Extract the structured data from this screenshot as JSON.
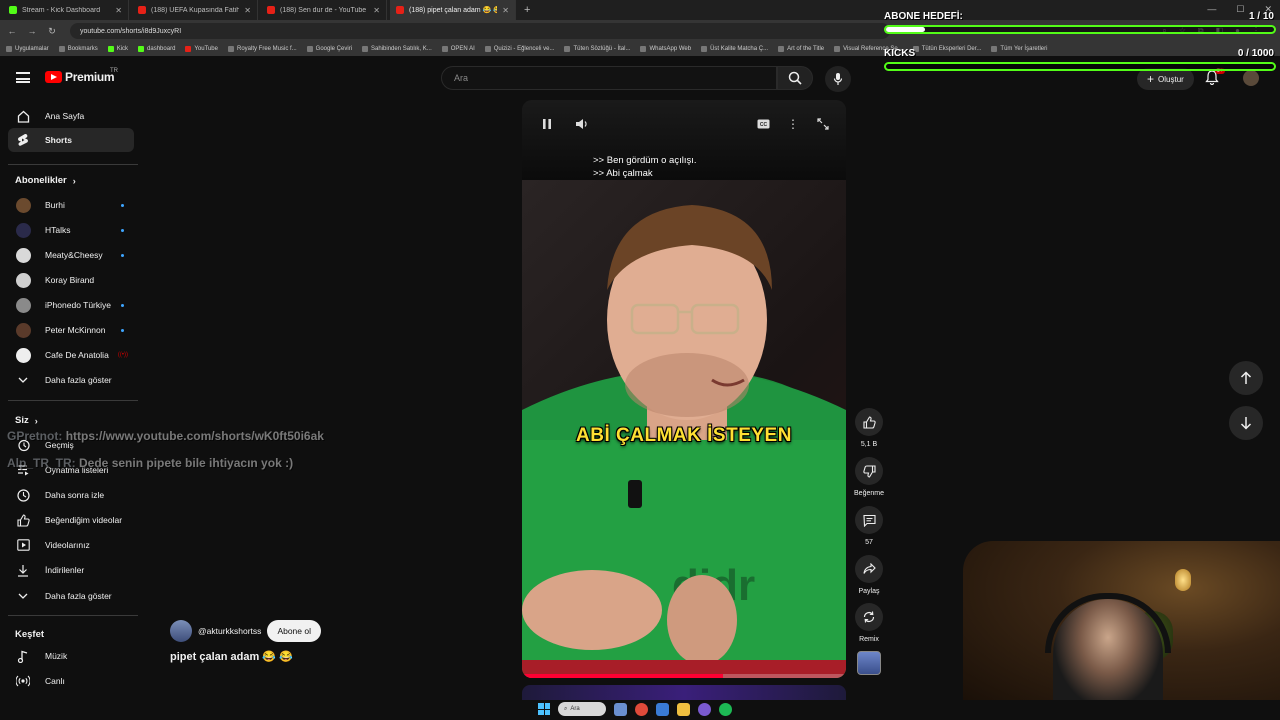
{
  "browser": {
    "tabs": [
      {
        "title": "Stream - Kick Dashboard",
        "icon": "kick-icon",
        "active": false
      },
      {
        "title": "(188) UEFA Kupasında Fatih Ter",
        "icon": "youtube-icon",
        "active": false
      },
      {
        "title": "(188) Sen dur de - YouTube",
        "icon": "youtube-icon",
        "active": false
      },
      {
        "title": "(188) pipet çalan adam 😂 😂",
        "icon": "youtube-icon",
        "active": true
      }
    ],
    "url": "youtube.com/shorts/i8d9JuxcyRI",
    "bookmarks": [
      {
        "label": "Uygulamalar",
        "kind": "apps"
      },
      {
        "label": "Bookmarks",
        "kind": "star"
      },
      {
        "label": "Kick",
        "kind": "kick"
      },
      {
        "label": "dashboard",
        "kind": "kick"
      },
      {
        "label": "YouTube",
        "kind": "yt"
      },
      {
        "label": "Royalty Free Music f...",
        "kind": "other"
      },
      {
        "label": "Google Çeviri",
        "kind": "other"
      },
      {
        "label": "Sahibinden Satılık, K...",
        "kind": "other"
      },
      {
        "label": "OPEN AI",
        "kind": "other"
      },
      {
        "label": "Quizizi - Eğlenceli ve...",
        "kind": "other"
      },
      {
        "label": "Tüten Sözlüğü - İtal...",
        "kind": "other"
      },
      {
        "label": "WhatsApp Web",
        "kind": "other"
      },
      {
        "label": "Üst Kalite Matcha Ç...",
        "kind": "other"
      },
      {
        "label": "Art of the Title",
        "kind": "other"
      },
      {
        "label": "Visual Reference Se...",
        "kind": "other"
      },
      {
        "label": "Tütün Eksperleri Der...",
        "kind": "other"
      },
      {
        "label": "Tüm Yer İşaretleri",
        "kind": "folder"
      }
    ]
  },
  "header": {
    "logo_text": "Premium",
    "country_code": "TR",
    "search_placeholder": "Ara",
    "create_label": "Oluştur",
    "notification_badge": "9+"
  },
  "sidebar": {
    "main_items": [
      {
        "label": "Ana Sayfa",
        "icon": "home-icon",
        "active": false
      },
      {
        "label": "Shorts",
        "icon": "shorts-icon",
        "active": true
      }
    ],
    "subscriptions_title": "Abonelikler",
    "subscriptions": [
      {
        "label": "Burhi",
        "dot": "blue",
        "color": "#6b4a2e"
      },
      {
        "label": "HTalks",
        "dot": "blue",
        "color": "#2a2a4a"
      },
      {
        "label": "Meaty&Cheesy",
        "dot": "blue",
        "color": "#d9d9d9"
      },
      {
        "label": "Koray Birand",
        "dot": "none",
        "color": "#cfcfcf"
      },
      {
        "label": "iPhonedo Türkiye",
        "dot": "blue",
        "color": "#8a8a8a"
      },
      {
        "label": "Peter McKinnon",
        "dot": "blue",
        "color": "#5a3a2a"
      },
      {
        "label": "Cafe De Anatolia",
        "dot": "live",
        "color": "#eeeeee"
      }
    ],
    "show_more_1": "Daha fazla göster",
    "you_title": "Siz",
    "you_items": [
      {
        "label": "Geçmiş",
        "icon": "history-icon"
      },
      {
        "label": "Oynatma listeleri",
        "icon": "playlist-icon"
      },
      {
        "label": "Daha sonra izle",
        "icon": "clock-icon"
      },
      {
        "label": "Beğendiğim videolar",
        "icon": "thumbs-up-icon"
      },
      {
        "label": "Videolarınız",
        "icon": "play-box-icon"
      },
      {
        "label": "İndirilenler",
        "icon": "download-icon"
      }
    ],
    "show_more_2": "Daha fazla göster",
    "explore_title": "Keşfet",
    "explore_items": [
      {
        "label": "Müzik",
        "icon": "music-icon"
      },
      {
        "label": "Canlı",
        "icon": "live-icon"
      }
    ]
  },
  "short": {
    "subtitle_line_1": ">> Ben gördüm o açılışı.",
    "subtitle_line_2": ">> Abi çalmak",
    "overlay_text": "ABİ ÇALMAK İSTEYEN",
    "channel_handle": "@akturkkshortss",
    "subscribe_label": "Abone ol",
    "title": "pipet çalan adam 😂 😂",
    "progress": 0.62
  },
  "actions": {
    "likes": "5,1 B",
    "dislike_label": "Beğenme",
    "comments": "57",
    "share_label": "Paylaş",
    "remix_label": "Remix"
  },
  "overlays": {
    "sub_goal": {
      "title": "ABONE HEDEFİ:",
      "current": "1",
      "target": "10",
      "fraction": 0.1
    },
    "kicks_goal": {
      "title": "KICKS",
      "current": "0",
      "target": "1000",
      "fraction": 0.0
    },
    "chat": [
      {
        "user": "GPretnot:",
        "message": "https://www.youtube.com/shorts/wK0ft50i6ak"
      },
      {
        "user": "Alp_TR_TR:",
        "message": "Dede senin pipete bile ihtiyacın yok :)"
      }
    ]
  },
  "taskbar": {
    "search_label": "Ara"
  },
  "colors": {
    "youtube_red": "#ff0000",
    "kick_green": "#53fc18",
    "caption_yellow": "#ffe033",
    "link_blue": "#3ea6ff"
  }
}
